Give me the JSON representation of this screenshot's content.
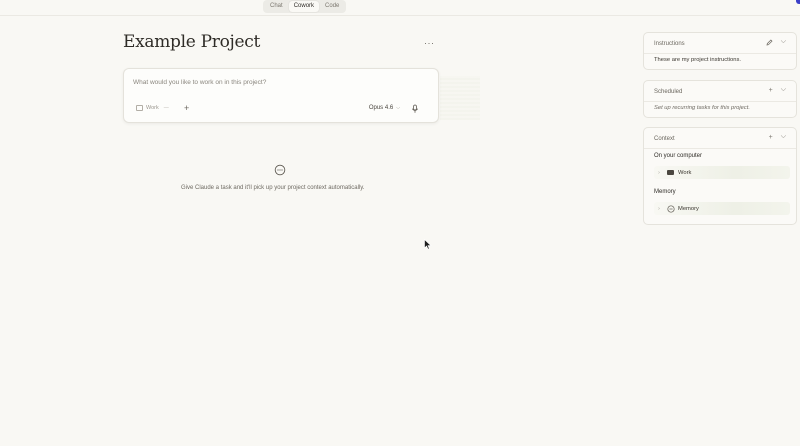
{
  "topbar": {
    "tabs": [
      {
        "label": "Chat",
        "active": false
      },
      {
        "label": "Cowork",
        "active": true
      },
      {
        "label": "Code",
        "active": false
      }
    ]
  },
  "project": {
    "title": "Example Project",
    "more_label": "···"
  },
  "composer": {
    "placeholder": "What would you like to work on in this project?",
    "folder_chip": "Work",
    "add_label": "+",
    "model": "Opus 4.6"
  },
  "empty_state": {
    "text": "Give Claude a task and it'll pick up your project context automatically."
  },
  "sidebar": {
    "instructions": {
      "title": "Instructions",
      "body": "These are my project instructions."
    },
    "scheduled": {
      "title": "Scheduled",
      "add_label": "+",
      "body": "Set up recurring tasks for this project."
    },
    "context": {
      "title": "Context",
      "add_label": "+",
      "computer_label": "On your computer",
      "folder_item": "Work",
      "memory_label": "Memory",
      "memory_item": "Memory"
    }
  },
  "colors": {
    "background": "#f9f8f4",
    "accent": "#3b3fc8"
  },
  "icons": [
    "folder-icon",
    "plus-icon",
    "chevron-down-icon",
    "microphone-icon",
    "chat-bubble-icon",
    "pencil-icon",
    "memory-icon",
    "cursor-icon"
  ]
}
